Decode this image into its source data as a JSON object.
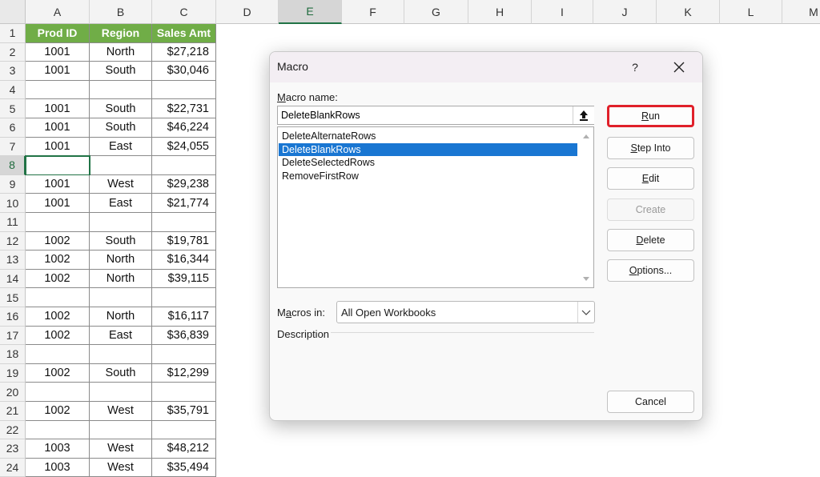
{
  "sheet": {
    "columns": [
      "A",
      "B",
      "C",
      "D",
      "E",
      "F",
      "G",
      "H",
      "I",
      "J",
      "K",
      "L",
      "M"
    ],
    "selected_column": "E",
    "selected_row": "8",
    "header_row": [
      "Prod ID",
      "Region",
      "Sales Amt"
    ],
    "rows": [
      {
        "n": "2",
        "a": "1001",
        "b": "North",
        "c": "$27,218"
      },
      {
        "n": "3",
        "a": "1001",
        "b": "South",
        "c": "$30,046"
      },
      {
        "n": "4",
        "a": "",
        "b": "",
        "c": ""
      },
      {
        "n": "5",
        "a": "1001",
        "b": "South",
        "c": "$22,731"
      },
      {
        "n": "6",
        "a": "1001",
        "b": "South",
        "c": "$46,224"
      },
      {
        "n": "7",
        "a": "1001",
        "b": "East",
        "c": "$24,055"
      },
      {
        "n": "8",
        "a": "",
        "b": "",
        "c": ""
      },
      {
        "n": "9",
        "a": "1001",
        "b": "West",
        "c": "$29,238"
      },
      {
        "n": "10",
        "a": "1001",
        "b": "East",
        "c": "$21,774"
      },
      {
        "n": "11",
        "a": "",
        "b": "",
        "c": ""
      },
      {
        "n": "12",
        "a": "1002",
        "b": "South",
        "c": "$19,781"
      },
      {
        "n": "13",
        "a": "1002",
        "b": "North",
        "c": "$16,344"
      },
      {
        "n": "14",
        "a": "1002",
        "b": "North",
        "c": "$39,115"
      },
      {
        "n": "15",
        "a": "",
        "b": "",
        "c": ""
      },
      {
        "n": "16",
        "a": "1002",
        "b": "North",
        "c": "$16,117"
      },
      {
        "n": "17",
        "a": "1002",
        "b": "East",
        "c": "$36,839"
      },
      {
        "n": "18",
        "a": "",
        "b": "",
        "c": ""
      },
      {
        "n": "19",
        "a": "1002",
        "b": "South",
        "c": "$12,299"
      },
      {
        "n": "20",
        "a": "",
        "b": "",
        "c": ""
      },
      {
        "n": "21",
        "a": "1002",
        "b": "West",
        "c": "$35,791"
      },
      {
        "n": "22",
        "a": "",
        "b": "",
        "c": ""
      },
      {
        "n": "23",
        "a": "1003",
        "b": "West",
        "c": "$48,212"
      },
      {
        "n": "24",
        "a": "1003",
        "b": "West",
        "c": "$35,494"
      }
    ],
    "colors": {
      "header_fill": "#70ad47",
      "selection": "#217346"
    }
  },
  "dialog": {
    "title": "Macro",
    "help_label": "?",
    "close_icon": "close-icon",
    "macro_name_label_accel": "M",
    "macro_name_label_rest": "acro name:",
    "macro_name_value": "DeleteBlankRows",
    "upload_icon": "upload-arrow-icon",
    "macros": [
      "DeleteAlternateRows",
      "DeleteBlankRows",
      "DeleteSelectedRows",
      "RemoveFirstRow"
    ],
    "selected_macro_index": 1,
    "buttons": {
      "run": {
        "accel": "R",
        "rest": "un"
      },
      "step_into": {
        "accel": "S",
        "rest": "tep Into"
      },
      "edit": {
        "accel": "E",
        "rest": "dit"
      },
      "create": "Create",
      "delete": {
        "accel": "D",
        "rest": "elete"
      },
      "options": {
        "accel": "O",
        "rest": "ptions..."
      },
      "cancel": "Cancel"
    },
    "macros_in_label_pre": "M",
    "macros_in_label_accel": "a",
    "macros_in_label_post": "cros in:",
    "macros_in_value": "All Open Workbooks",
    "description_label": "Description",
    "highlight_color": "#e0202a",
    "selected_item_color": "#1976d2"
  }
}
